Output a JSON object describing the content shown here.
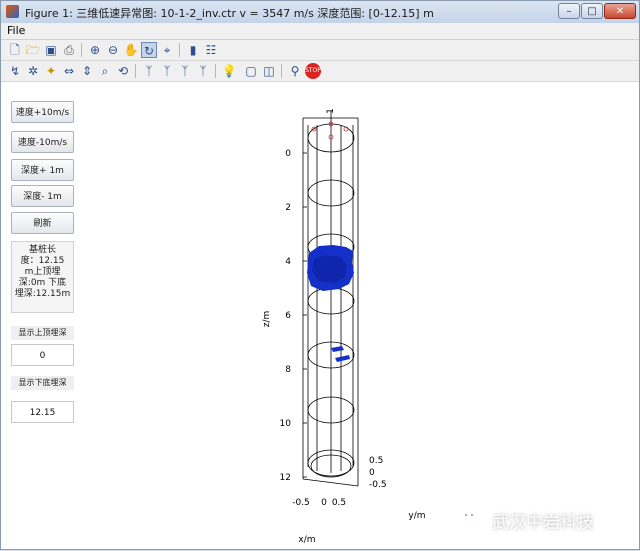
{
  "window": {
    "title": "Figure 1: 三维低速异常图: 10-1-2_inv.ctr v = 3547 m/s 深度范围: [0-12.15] m",
    "minimize": "–",
    "maximize": "□",
    "close": "✕"
  },
  "menu": {
    "file": "File"
  },
  "buttons": {
    "speed_up": "速度+10m/s",
    "speed_down": "速度-10m/s",
    "depth_up": "深度+ 1m",
    "depth_down": "深度- 1m",
    "refresh": "刷新"
  },
  "info": {
    "line1": "基桩长",
    "line2": "度：12.15",
    "line3": "m上顶埋",
    "line4": "深:0m 下底",
    "line5": "埋深:12.15m"
  },
  "fields": {
    "top_label": "显示上顶埋深",
    "top_value": "0",
    "bottom_label": "显示下底埋深",
    "bottom_value": "12.15"
  },
  "plot": {
    "zlabel": "z/m",
    "ylabel": "y/m",
    "xlabel": "x/m",
    "z_ticks": [
      "0",
      "2",
      "4",
      "6",
      "8",
      "10",
      "12"
    ],
    "x_ticks": [
      "-0.5",
      "0",
      "0.5"
    ],
    "y_ticks": [
      "0.5",
      "0",
      "-0.5"
    ],
    "top_tick": "1"
  },
  "watermark": {
    "text": "武汉中岩科技"
  },
  "colors": {
    "anomaly": "#1530c8",
    "frame": "#000000"
  }
}
